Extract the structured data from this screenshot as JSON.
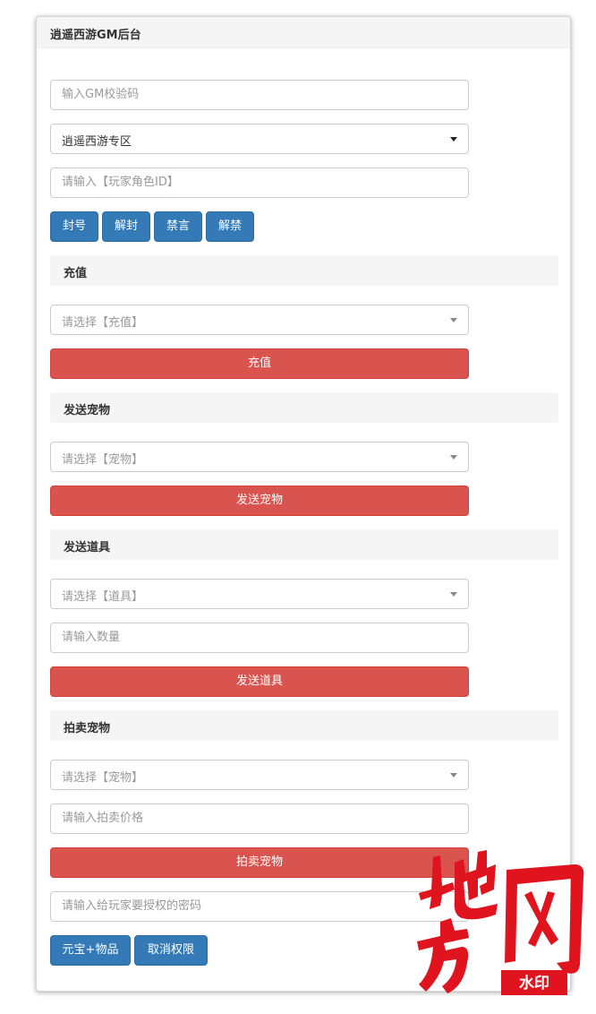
{
  "panel": {
    "title": "逍遥西游GM后台"
  },
  "gm_code": {
    "placeholder": "输入GM校验码"
  },
  "server_select": {
    "selected": "逍遥西游专区"
  },
  "role_id": {
    "placeholder": "请输入【玩家角色ID】"
  },
  "account_buttons": [
    "封号",
    "解封",
    "禁言",
    "解禁"
  ],
  "recharge": {
    "section_title": "充值",
    "select_placeholder": "请选择【充值】",
    "button": "充值"
  },
  "send_pet": {
    "section_title": "发送宠物",
    "select_placeholder": "请选择【宠物】",
    "button": "发送宠物"
  },
  "send_item": {
    "section_title": "发送道具",
    "select_placeholder": "请选择【道具】",
    "quantity_placeholder": "请输入数量",
    "button": "发送道具"
  },
  "auction_pet": {
    "section_title": "拍卖宠物",
    "select_placeholder": "请选择【宠物】",
    "price_placeholder": "请输入拍卖价格",
    "button": "拍卖宠物"
  },
  "auth": {
    "password_placeholder": "请输入给玩家要授权的密码",
    "grant_button": "元宝+物品",
    "revoke_button": "取消权限"
  },
  "watermark": {
    "text": "地方网",
    "badge": "水印",
    "color": "#e0141e"
  },
  "colors": {
    "primary": "#337ab7",
    "danger": "#d9534f",
    "section_bg": "#f5f5f5"
  }
}
